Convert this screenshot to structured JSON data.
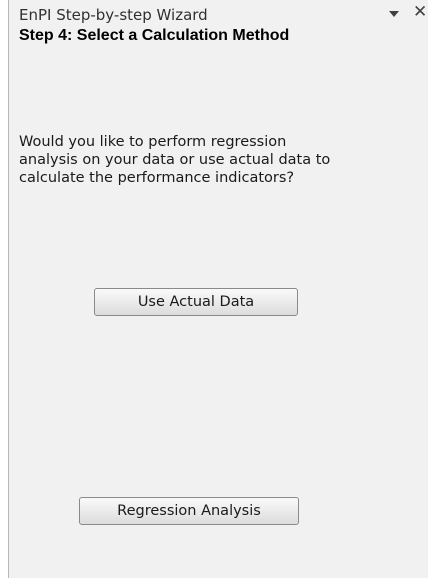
{
  "pane": {
    "title": "EnPI Step-by-step Wizard",
    "dropdown_icon": "chevron-down-icon",
    "close_icon": "close-icon",
    "close_glyph": "✕"
  },
  "step": {
    "heading": "Step 4: Select a Calculation Method",
    "question": "Would you like to perform regression analysis on your data or use actual data to calculate the performance indicators?"
  },
  "buttons": {
    "use_actual_label": "Use Actual Data",
    "regression_label": "Regression Analysis"
  }
}
